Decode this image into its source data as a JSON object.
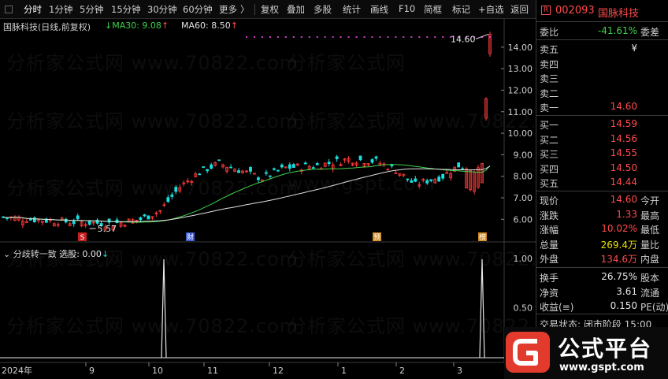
{
  "toolbar": {
    "items": [
      "分时",
      "1分钟",
      "5分钟",
      "15分钟",
      "30分钟",
      "60分钟",
      "更多",
      "复权",
      "叠加",
      "多股",
      "统计",
      "画线",
      "F10",
      "简框",
      "标记",
      "+自选",
      "返回"
    ],
    "more_arrow": "〉"
  },
  "stock": {
    "badge": "R",
    "code": "002093",
    "name": "国脉科技"
  },
  "legend": {
    "name": "国脉科技",
    "mode": "(日线,前复权)",
    "ma30": "MA30: 9.08",
    "ma60": "MA60: 8.50",
    "up_arrow": "↑",
    "indicator_name": "分歧转一致",
    "indicator_value": "选股: 0.00",
    "down_arrow": "↓"
  },
  "price_axis": [
    "14.00",
    "13.00",
    "12.00",
    "11.00",
    "10.00",
    "9.00",
    "8.00",
    "7.00",
    "6.00"
  ],
  "indicator_axis": [
    "1.00",
    "0.50",
    "0.00"
  ],
  "time_axis": [
    "2024年",
    "9",
    "10",
    "11",
    "12",
    "1",
    "2",
    "3"
  ],
  "annotations": {
    "high_label": "14.60",
    "low_label": "5.57",
    "badge_s": "S",
    "badge_cai": "财",
    "badge_yu": "预",
    "badge_bang": "榜"
  },
  "watermark": {
    "text": "分析家公式网",
    "site": "www.70822.com",
    "site2": "www.gspt.com"
  },
  "sidebar": {
    "weibi_label": "委比",
    "weibi_value": "-41.61%",
    "weicha_label": "委差",
    "asks": [
      {
        "label": "卖五",
        "price": "¥"
      },
      {
        "label": "卖四",
        "price": ""
      },
      {
        "label": "卖三",
        "price": ""
      },
      {
        "label": "卖二",
        "price": ""
      },
      {
        "label": "卖一",
        "price": "14.60"
      }
    ],
    "bids": [
      {
        "label": "买一",
        "price": "14.59"
      },
      {
        "label": "买二",
        "price": "14.56"
      },
      {
        "label": "买三",
        "price": "14.55"
      },
      {
        "label": "买四",
        "price": "14.50"
      },
      {
        "label": "买五",
        "price": "14.44"
      }
    ],
    "quote": [
      {
        "label": "现价",
        "value": "14.60",
        "label2": "今开"
      },
      {
        "label": "涨跌",
        "value": "1.33",
        "label2": "最高"
      },
      {
        "label": "涨幅",
        "value": "10.02%",
        "label2": "最低"
      },
      {
        "label": "总量",
        "value": "269.4万",
        "label2": "量比"
      },
      {
        "label": "外盘",
        "value": "134.6万",
        "label2": "内盘"
      }
    ],
    "fin": [
      {
        "label": "换手",
        "value": "26.75%",
        "label2": "股本"
      },
      {
        "label": "净资",
        "value": "3.61",
        "label2": "流通"
      },
      {
        "label": "收益(≡)",
        "value": "0.150",
        "label2": "PE(动)"
      }
    ],
    "status": "交易状态: 闭市阶段 15:00"
  },
  "brand": {
    "name": "公式平台",
    "url": "www.gspt.com"
  },
  "chart_data": {
    "type": "candlestick",
    "ma30_last": 9.08,
    "ma60_last": 8.5,
    "high": 14.6,
    "low": 5.57,
    "ylim": [
      5.5,
      14.8
    ],
    "indicator": {
      "name": "分歧转一致",
      "ylim": [
        0,
        1
      ],
      "spikes_at_months": [
        "10",
        "3"
      ]
    }
  },
  "colors": {
    "up": "#ff3b3b",
    "down": "#19e0e0",
    "ma30": "#3fd24a",
    "ma60": "#e0e0e0",
    "accent": "#ff4b4b"
  }
}
